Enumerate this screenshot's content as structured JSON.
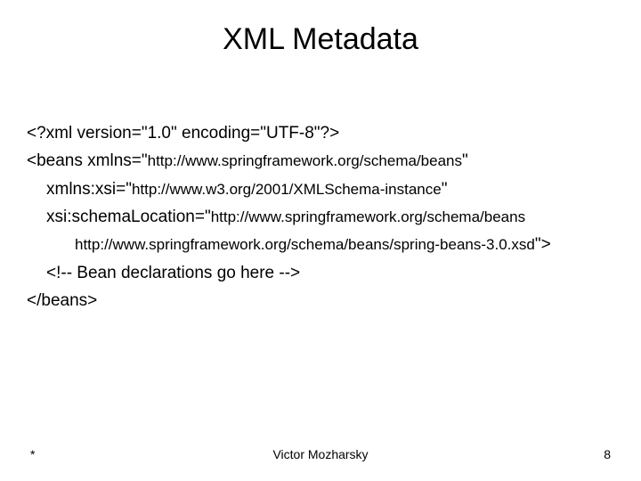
{
  "title": "XML Metadata",
  "code": {
    "line1": "<?xml version=\"1.0\" encoding=\"UTF-8\"?>",
    "line2a": "<beans xmlns=\"",
    "line2b": "http://www.springframework.org/schema/beans",
    "line2c": "\"",
    "line3a": "xmlns:xsi=\"",
    "line3b": "http://www.w3.org/2001/XMLSchema-instance",
    "line3c": "\"",
    "line4a": "xsi:schemaLocation=\"",
    "line4b": "http://www.springframework.org/schema/beans",
    "line5a": "http://www.springframework.org/schema/beans/spring-beans-3.0.xsd",
    "line5b": "\">",
    "line6": "<!-- Bean declarations go here -->",
    "line7": "</beans>"
  },
  "footer": {
    "left": "*",
    "center": "Victor Mozharsky",
    "right": "8"
  }
}
